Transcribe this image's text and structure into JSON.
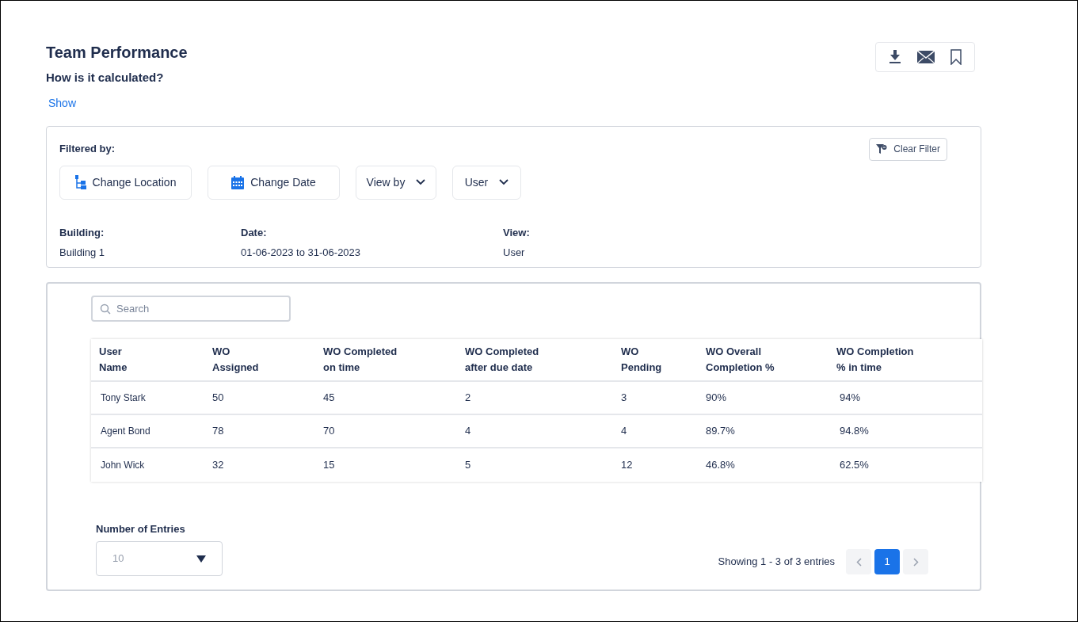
{
  "header": {
    "title": "Team Performance",
    "subtitle": "How is it calculated?",
    "toggle_link": "Show"
  },
  "filter_panel": {
    "label": "Filtered by:",
    "clear_button": "Clear Filter",
    "buttons": [
      {
        "kind": "location",
        "label": "Change Location"
      },
      {
        "kind": "date",
        "label": "Change Date"
      },
      {
        "kind": "dropdown",
        "label": "View by"
      },
      {
        "kind": "dropdown",
        "label": "User"
      }
    ],
    "summary": [
      {
        "label": "Building:",
        "value": "Building 1"
      },
      {
        "label": "Date:",
        "value": "01-06-2023 to 31-06-2023"
      },
      {
        "label": "View:",
        "value": "User"
      }
    ]
  },
  "search": {
    "placeholder": "Search"
  },
  "table": {
    "columns": [
      "User\nName",
      "WO\nAssigned",
      "WO Completed\non time",
      "WO Completed\nafter due date",
      "WO\nPending",
      "WO Overall\nCompletion %",
      "WO Completion\n% in time"
    ],
    "rows": [
      [
        "Tony Stark",
        "50",
        "45",
        "2",
        "3",
        "90%",
        "94%"
      ],
      [
        "Agent Bond",
        "78",
        "70",
        "4",
        "4",
        "89.7%",
        "94.8%"
      ],
      [
        "John Wick",
        "32",
        "15",
        "5",
        "12",
        "46.8%",
        "62.5%"
      ]
    ]
  },
  "entries": {
    "label": "Number of  Entries",
    "value": "10"
  },
  "pagination": {
    "summary": "Showing 1 - 3 of 3 entries",
    "prev_disabled": true,
    "next_disabled": true,
    "pages": [
      {
        "label": "1",
        "selected": true
      }
    ]
  }
}
